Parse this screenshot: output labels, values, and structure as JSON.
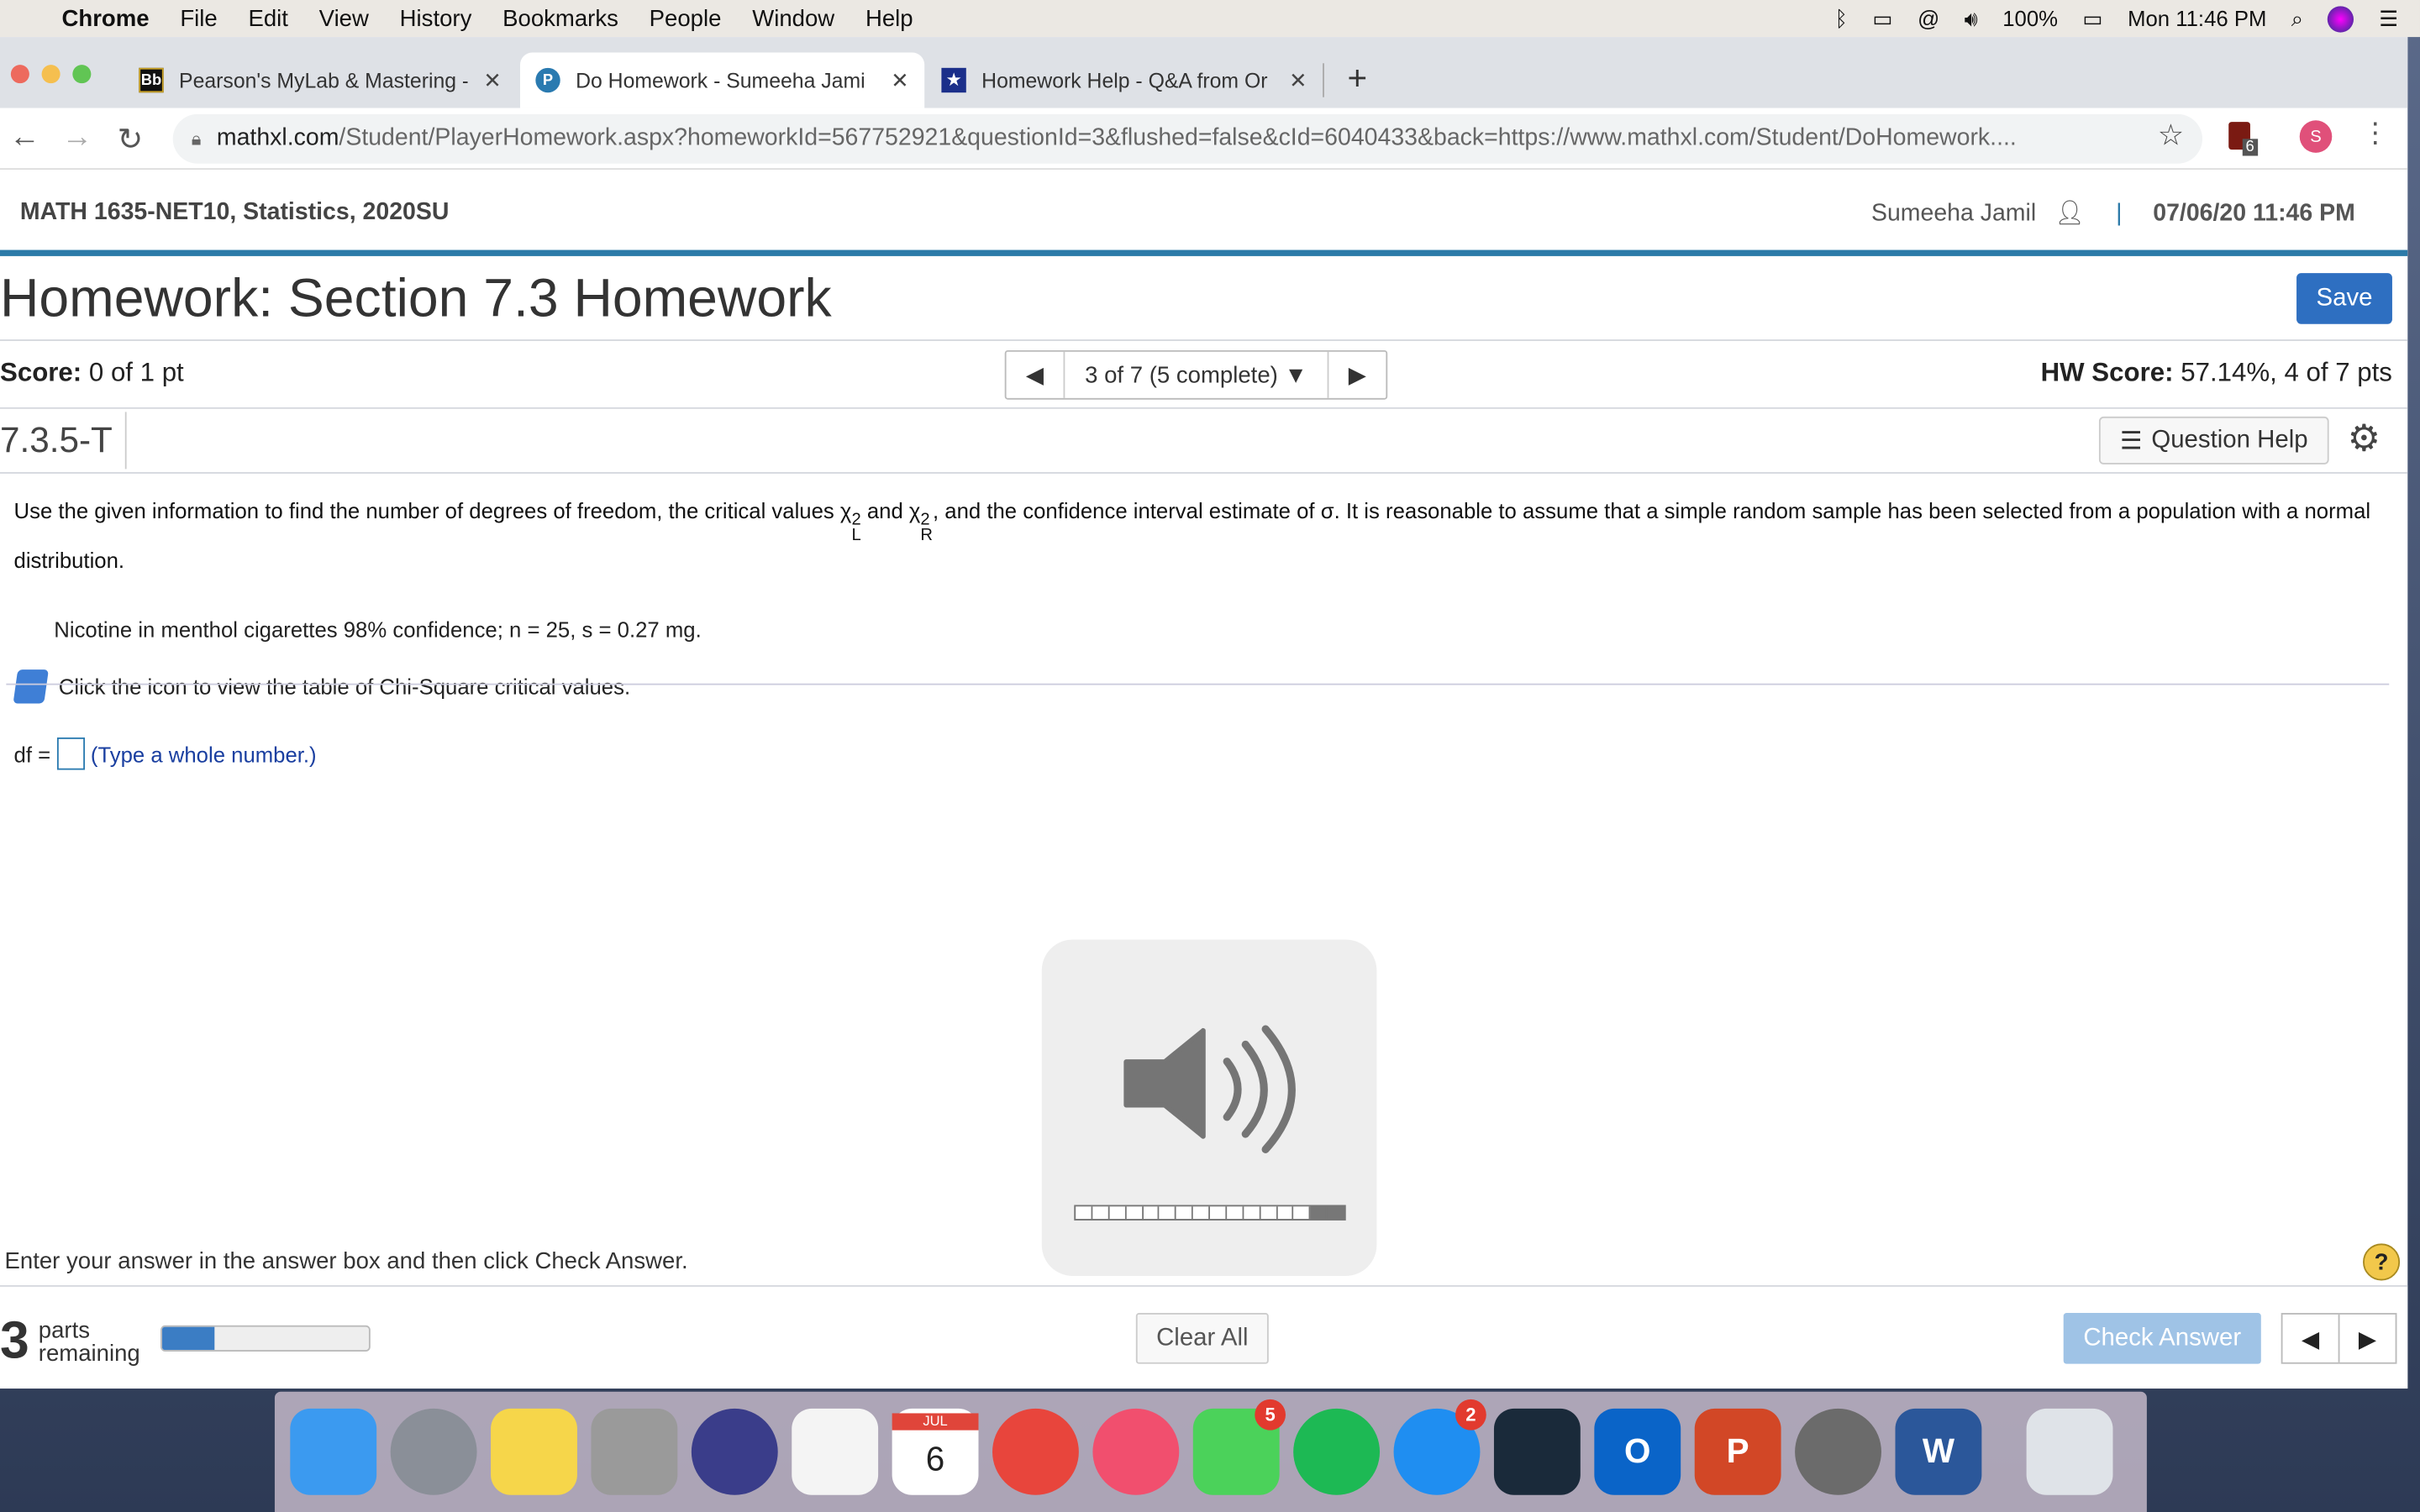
{
  "menubar": {
    "apple": "",
    "app": "Chrome",
    "items": [
      "File",
      "Edit",
      "View",
      "History",
      "Bookmarks",
      "People",
      "Window",
      "Help"
    ],
    "battery": "100%",
    "clock": "Mon 11:46 PM"
  },
  "tabs": [
    {
      "label": "Pearson's MyLab & Mastering -",
      "favicon": "Bb"
    },
    {
      "label": "Do Homework - Sumeeha Jami",
      "favicon": "P",
      "active": true
    },
    {
      "label": "Homework Help - Q&A from Or",
      "favicon": "★"
    }
  ],
  "new_tab": "+",
  "address": {
    "host": "mathxl.com",
    "path": "/Student/PlayerHomework.aspx?homeworkId=567752921&questionId=3&flushed=false&cId=6040433&back=https://www.mathxl.com/Student/DoHomework...."
  },
  "extension_badge": "6",
  "profile_initial": "S",
  "course": {
    "title": "MATH 1635-NET10, Statistics, 2020SU",
    "user": "Sumeeha Jamil",
    "sep": "|",
    "datetime": "07/06/20 11:46 PM"
  },
  "homework": {
    "title": "Homework: Section 7.3 Homework",
    "save": "Save",
    "score_label": "Score:",
    "score": "0 of 1 pt",
    "nav": "3 of 7 (5 complete)",
    "hw_score_label": "HW Score:",
    "hw_score": "57.14%, 4 of 7 pts",
    "question_id": "7.3.5-T",
    "question_help": "Question Help"
  },
  "question": {
    "text1": "Use the given information to find the number of degrees of freedom, the critical values ",
    "chi": "χ",
    "sup": "2",
    "subL": "L",
    "and": " and ",
    "subR": "R",
    "text2": ", and the confidence interval estimate of σ. It is reasonable to assume that a simple random sample has been selected from a population with a normal distribution.",
    "given": "Nicotine in menthol cigarettes 98% confidence; n = 25, s = 0.27 mg.",
    "table_link": "Click the icon to view the table of Chi-Square critical values.",
    "df_label": "df =",
    "df_value": "",
    "df_hint": "(Type a whole number.)"
  },
  "volume_hud": {
    "level_segments": 14,
    "total_segments": 16
  },
  "footer": {
    "instruction": "Enter your answer in the answer box and then click Check Answer.",
    "help": "?",
    "parts_count": "3",
    "parts_label1": "parts",
    "parts_label2": "remaining",
    "progress": 0.25,
    "clear_all": "Clear All",
    "check_answer": "Check Answer"
  },
  "dock": [
    {
      "name": "Finder",
      "color": "#3b9af0"
    },
    {
      "name": "Launchpad",
      "color": "#8a8f98"
    },
    {
      "name": "Notes",
      "color": "#f6d64a"
    },
    {
      "name": "Calculator",
      "color": "#9a9a9a"
    },
    {
      "name": "Siri",
      "color": "#3a3d8a"
    },
    {
      "name": "Reminders",
      "color": "#f4f4f4"
    },
    {
      "name": "Calendar",
      "color": "#ffffff",
      "label": "6",
      "month": "JUL"
    },
    {
      "name": "Chrome",
      "color": "#e8453c"
    },
    {
      "name": "Music",
      "color": "#f14f6e"
    },
    {
      "name": "FaceTime",
      "color": "#4bd25a",
      "badge": "5"
    },
    {
      "name": "Spotify",
      "color": "#1db954"
    },
    {
      "name": "App Store",
      "color": "#1f8ef1",
      "badge": "2"
    },
    {
      "name": "Kindle",
      "color": "#1a2a3a"
    },
    {
      "name": "Outlook",
      "color": "#0a64c8",
      "label": "O"
    },
    {
      "name": "PowerPoint",
      "color": "#d24726",
      "label": "P"
    },
    {
      "name": "System Preferences",
      "color": "#6b6b6b"
    },
    {
      "name": "Word",
      "color": "#2b579a",
      "label": "W"
    },
    {
      "name": "Trash",
      "color": "#dfe3e8"
    }
  ]
}
